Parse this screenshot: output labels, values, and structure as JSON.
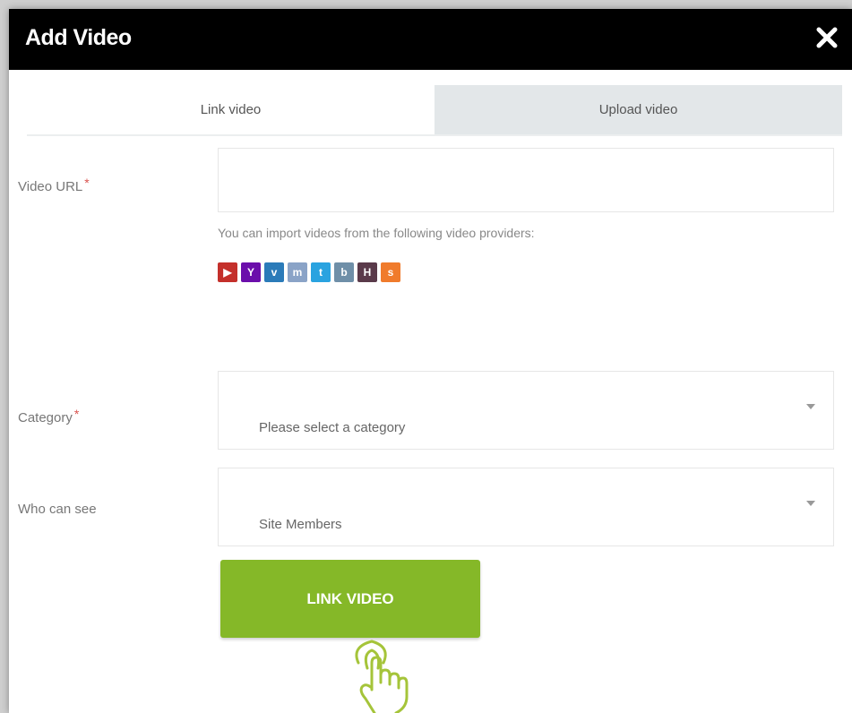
{
  "dialog": {
    "title": "Add Video",
    "close_icon": "close-icon"
  },
  "tabs": [
    {
      "label": "Link video",
      "active": true
    },
    {
      "label": "Upload video",
      "active": false
    }
  ],
  "form": {
    "video_url": {
      "label": "Video URL",
      "required_mark": "*",
      "value": "",
      "placeholder": ""
    },
    "providers_help": "You can import videos from the following video providers:",
    "providers": [
      {
        "icon": "youtube-icon",
        "glyph": "▶",
        "color": "#c4302b"
      },
      {
        "icon": "yahoo-icon",
        "glyph": "Y",
        "color": "#6b0eab"
      },
      {
        "icon": "vimeo-icon",
        "glyph": "v",
        "color": "#2b7bb9"
      },
      {
        "icon": "myspace-icon",
        "glyph": "m",
        "color": "#8aa3c7"
      },
      {
        "icon": "twitter-icon",
        "glyph": "t",
        "color": "#2aa3e0"
      },
      {
        "icon": "provider-icon",
        "glyph": "b",
        "color": "#6f8fa8"
      },
      {
        "icon": "provider-icon",
        "glyph": "H",
        "color": "#5a3a4a"
      },
      {
        "icon": "soundcloud-icon",
        "glyph": "s",
        "color": "#f07b2c"
      }
    ],
    "category": {
      "label": "Category",
      "required_mark": "*",
      "value": "Please select a category"
    },
    "who_can_see": {
      "label": "Who can see",
      "value": "Site Members"
    },
    "submit_label": "LINK VIDEO"
  },
  "colors": {
    "header_bg": "#000000",
    "accent_green": "#85b828",
    "inactive_tab": "#e3e7e9",
    "required": "#d9534f"
  }
}
